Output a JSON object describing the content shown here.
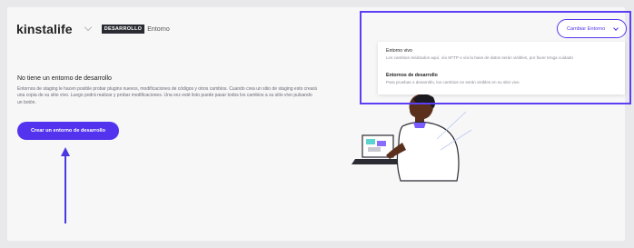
{
  "header": {
    "logo": "kinstalife",
    "badge": "DESARROLLO",
    "environment_label": "Entorno"
  },
  "main": {
    "title": "No tiene un entorno de desarrollo",
    "description": "Entornos de staging le hacen posible probar plugins nuevos, modificaciones de códigos y otros cambios. Cuando crea un sitio de staging esto creará una copia de su sitio vivo. Luego podrá realizar y probar modificaciones. Una vez esté listo puede pasar todos los cambios a su sitio vivo pulsando un botón.",
    "create_button": "Crear un entorno de desarrollo"
  },
  "env_switcher": {
    "button_label": "Cambiar Entorno",
    "options": [
      {
        "title": "Entorno vivo",
        "description": "Los cambios realizados aquí, vía SFTP o vía la base de datos serán visibles, por favor tenga cuidado"
      },
      {
        "title": "Entornos de desarrollo",
        "description": "Para pruebas o desarrollo, los cambios no serán visibles en su sitio vivo"
      }
    ]
  },
  "colors": {
    "accent": "#5333ed",
    "highlight": "#5b3ff5",
    "badge_bg": "#2b2b33"
  },
  "icons": [
    "chevron-down-icon",
    "arrow-up-icon"
  ]
}
